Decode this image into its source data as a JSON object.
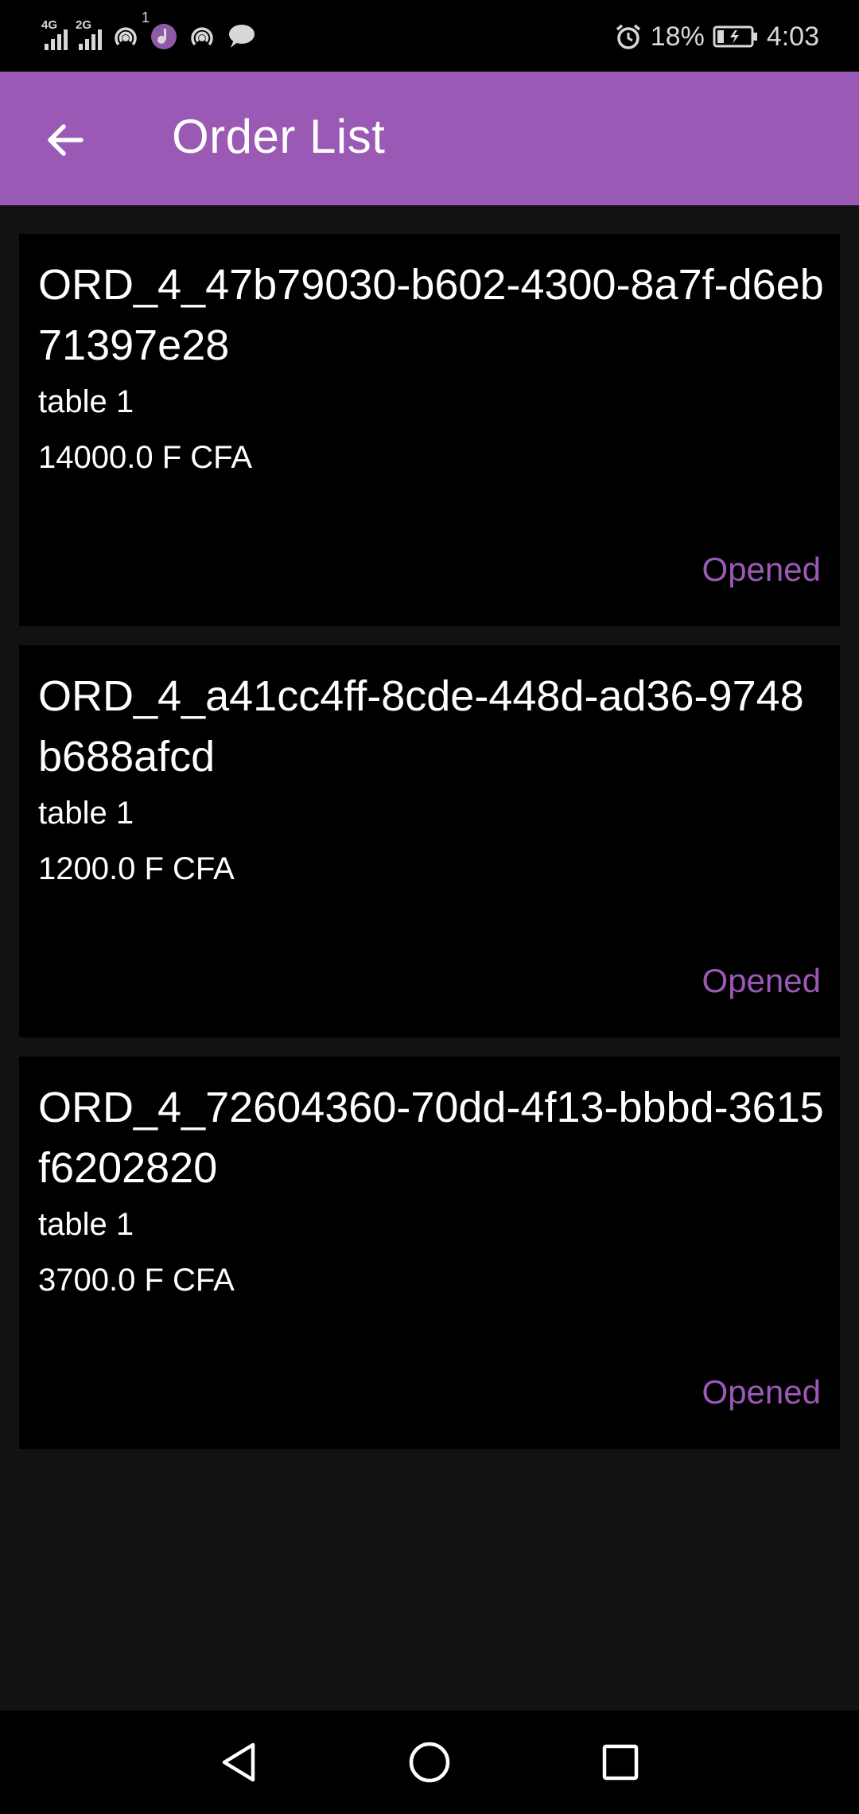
{
  "status_bar": {
    "signal1_label": "4G",
    "signal2_label": "2G",
    "hotspot_badge": "1",
    "battery": "18%",
    "time": "4:03"
  },
  "app_bar": {
    "title": "Order List"
  },
  "orders": [
    {
      "id": "ORD_4_47b79030-b602-4300-8a7f-d6eb71397e28",
      "table": "table 1",
      "amount": "14000.0 F CFA",
      "status": "Opened"
    },
    {
      "id": "ORD_4_a41cc4ff-8cde-448d-ad36-9748b688afcd",
      "table": "table 1",
      "amount": "1200.0 F CFA",
      "status": "Opened"
    },
    {
      "id": "ORD_4_72604360-70dd-4f13-bbbd-3615f6202820",
      "table": "table 1",
      "amount": "3700.0 F CFA",
      "status": "Opened"
    }
  ],
  "colors": {
    "accent": "#9b59b6",
    "background": "#121212",
    "card": "#000000"
  }
}
